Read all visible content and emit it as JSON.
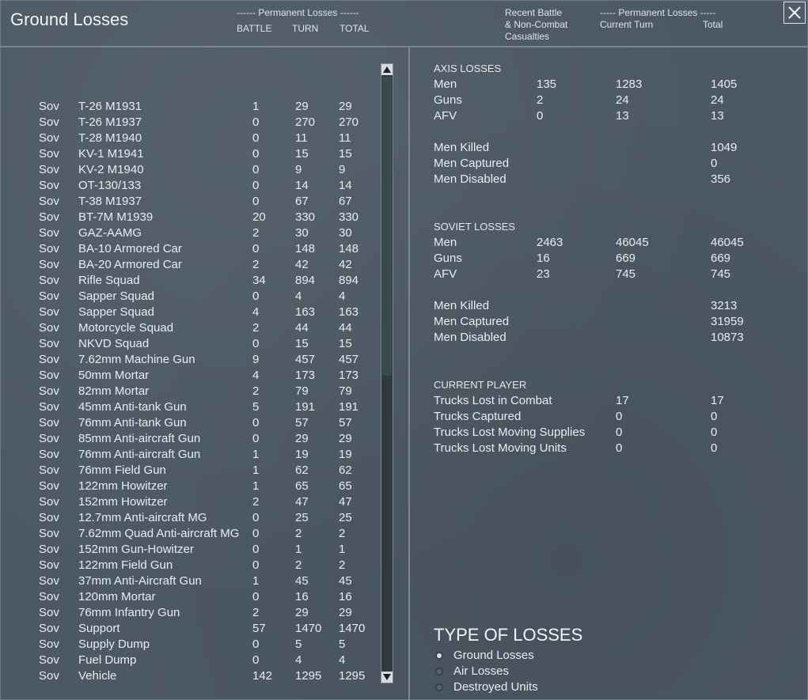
{
  "header": {
    "title": "Ground Losses",
    "perm_losses_label": "------ Permanent Losses ------",
    "col_battle": "BATTLE",
    "col_turn": "TURN",
    "col_total": "TOTAL",
    "recent_battle_line1": "Recent Battle",
    "recent_battle_line2": "& Non-Combat",
    "recent_battle_line3": "Casualties",
    "right_perm_label": "----- Permanent Losses -----",
    "current_turn": "Current Turn",
    "total": "Total"
  },
  "units": [
    {
      "side": "Sov",
      "name": "T-26 M1931",
      "battle": "1",
      "turn": "29",
      "total": "29"
    },
    {
      "side": "Sov",
      "name": "T-26 M1937",
      "battle": "0",
      "turn": "270",
      "total": "270"
    },
    {
      "side": "Sov",
      "name": "T-28 M1940",
      "battle": "0",
      "turn": "11",
      "total": "11"
    },
    {
      "side": "Sov",
      "name": "KV-1 M1941",
      "battle": "0",
      "turn": "15",
      "total": "15"
    },
    {
      "side": "Sov",
      "name": "KV-2 M1940",
      "battle": "0",
      "turn": "9",
      "total": "9"
    },
    {
      "side": "Sov",
      "name": "OT-130/133",
      "battle": "0",
      "turn": "14",
      "total": "14"
    },
    {
      "side": "Sov",
      "name": "T-38 M1937",
      "battle": "0",
      "turn": "67",
      "total": "67"
    },
    {
      "side": "Sov",
      "name": "BT-7M M1939",
      "battle": "20",
      "turn": "330",
      "total": "330"
    },
    {
      "side": "Sov",
      "name": "GAZ-AAMG",
      "battle": "2",
      "turn": "30",
      "total": "30"
    },
    {
      "side": "Sov",
      "name": "BA-10 Armored Car",
      "battle": "0",
      "turn": "148",
      "total": "148"
    },
    {
      "side": "Sov",
      "name": "BA-20 Armored Car",
      "battle": "2",
      "turn": "42",
      "total": "42"
    },
    {
      "side": "Sov",
      "name": "Rifle Squad",
      "battle": "34",
      "turn": "894",
      "total": "894"
    },
    {
      "side": "Sov",
      "name": "Sapper Squad",
      "battle": "0",
      "turn": "4",
      "total": "4"
    },
    {
      "side": "Sov",
      "name": "Sapper Squad",
      "battle": "4",
      "turn": "163",
      "total": "163"
    },
    {
      "side": "Sov",
      "name": "Motorcycle Squad",
      "battle": "2",
      "turn": "44",
      "total": "44"
    },
    {
      "side": "Sov",
      "name": "NKVD Squad",
      "battle": "0",
      "turn": "15",
      "total": "15"
    },
    {
      "side": "Sov",
      "name": "7.62mm Machine Gun",
      "battle": "9",
      "turn": "457",
      "total": "457"
    },
    {
      "side": "Sov",
      "name": "50mm Mortar",
      "battle": "4",
      "turn": "173",
      "total": "173"
    },
    {
      "side": "Sov",
      "name": "82mm Mortar",
      "battle": "2",
      "turn": "79",
      "total": "79"
    },
    {
      "side": "Sov",
      "name": "45mm Anti-tank Gun",
      "battle": "5",
      "turn": "191",
      "total": "191"
    },
    {
      "side": "Sov",
      "name": "76mm Anti-tank Gun",
      "battle": "0",
      "turn": "57",
      "total": "57"
    },
    {
      "side": "Sov",
      "name": "85mm Anti-aircraft Gun",
      "battle": "0",
      "turn": "29",
      "total": "29"
    },
    {
      "side": "Sov",
      "name": "76mm Anti-aircraft Gun",
      "battle": "1",
      "turn": "19",
      "total": "19"
    },
    {
      "side": "Sov",
      "name": "76mm Field Gun",
      "battle": "1",
      "turn": "62",
      "total": "62"
    },
    {
      "side": "Sov",
      "name": "122mm Howitzer",
      "battle": "1",
      "turn": "65",
      "total": "65"
    },
    {
      "side": "Sov",
      "name": "152mm Howitzer",
      "battle": "2",
      "turn": "47",
      "total": "47"
    },
    {
      "side": "Sov",
      "name": "12.7mm Anti-aircraft MG",
      "battle": "0",
      "turn": "25",
      "total": "25"
    },
    {
      "side": "Sov",
      "name": "7.62mm Quad Anti-aircraft MG",
      "battle": "0",
      "turn": "2",
      "total": "2"
    },
    {
      "side": "Sov",
      "name": "152mm Gun-Howitzer",
      "battle": "0",
      "turn": "1",
      "total": "1"
    },
    {
      "side": "Sov",
      "name": "122mm Field Gun",
      "battle": "0",
      "turn": "2",
      "total": "2"
    },
    {
      "side": "Sov",
      "name": "37mm Anti-Aircraft Gun",
      "battle": "1",
      "turn": "45",
      "total": "45"
    },
    {
      "side": "Sov",
      "name": "120mm Mortar",
      "battle": "0",
      "turn": "16",
      "total": "16"
    },
    {
      "side": "Sov",
      "name": "76mm Infantry Gun",
      "battle": "2",
      "turn": "29",
      "total": "29"
    },
    {
      "side": "Sov",
      "name": "Support",
      "battle": "57",
      "turn": "1470",
      "total": "1470"
    },
    {
      "side": "Sov",
      "name": "Supply Dump",
      "battle": "0",
      "turn": "5",
      "total": "5"
    },
    {
      "side": "Sov",
      "name": "Fuel Dump",
      "battle": "0",
      "turn": "4",
      "total": "4"
    },
    {
      "side": "Sov",
      "name": "Vehicle",
      "battle": "142",
      "turn": "1295",
      "total": "1295"
    }
  ],
  "axis": {
    "title": "AXIS LOSSES",
    "rows": [
      {
        "label": "Men",
        "recent": "135",
        "turn": "1283",
        "total": "1405"
      },
      {
        "label": "Guns",
        "recent": "2",
        "turn": "24",
        "total": "24"
      },
      {
        "label": "AFV",
        "recent": "0",
        "turn": "13",
        "total": "13"
      }
    ],
    "details": [
      {
        "label": "Men Killed",
        "value": "1049"
      },
      {
        "label": "Men Captured",
        "value": "0"
      },
      {
        "label": "Men Disabled",
        "value": "356"
      }
    ]
  },
  "soviet": {
    "title": "SOVIET LOSSES",
    "rows": [
      {
        "label": "Men",
        "recent": "2463",
        "turn": "46045",
        "total": "46045"
      },
      {
        "label": "Guns",
        "recent": "16",
        "turn": "669",
        "total": "669"
      },
      {
        "label": "AFV",
        "recent": "23",
        "turn": "745",
        "total": "745"
      }
    ],
    "details": [
      {
        "label": "Men Killed",
        "value": "3213"
      },
      {
        "label": "Men Captured",
        "value": "31959"
      },
      {
        "label": "Men Disabled",
        "value": "10873"
      }
    ]
  },
  "current_player": {
    "title": "CURRENT PLAYER",
    "rows": [
      {
        "label": "Trucks Lost in Combat",
        "turn": "17",
        "total": "17"
      },
      {
        "label": "Trucks Captured",
        "turn": "0",
        "total": "0"
      },
      {
        "label": "Trucks Lost Moving Supplies",
        "turn": "0",
        "total": "0"
      },
      {
        "label": "Trucks Lost Moving Units",
        "turn": "0",
        "total": "0"
      }
    ]
  },
  "type_of_losses": {
    "title": "TYPE OF LOSSES",
    "options": [
      "Ground Losses",
      "Air Losses",
      "Destroyed Units"
    ],
    "selected": "Ground Losses"
  }
}
